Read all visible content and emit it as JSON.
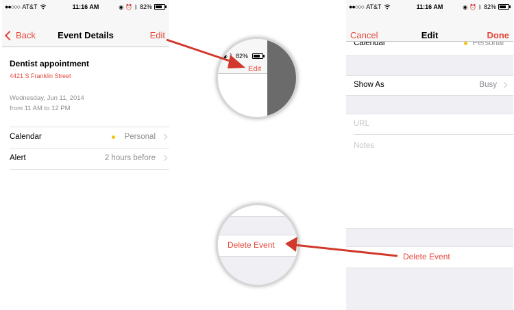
{
  "left_screen": {
    "status": {
      "signal": "●●○○○",
      "carrier": "AT&T",
      "time": "11:16 AM",
      "battery": "82%"
    },
    "nav": {
      "back_label": "Back",
      "title": "Event Details",
      "edit_label": "Edit"
    },
    "event": {
      "title": "Dentist appointment",
      "location": "4421 S Franklin Street",
      "date": "Wednesday, Jun 11, 2014",
      "time": "from 11 AM to 12 PM"
    },
    "rows": [
      {
        "label": "Calendar",
        "value": "Personal"
      },
      {
        "label": "Alert",
        "value": "2 hours before"
      }
    ]
  },
  "zoom_top": {
    "battery": "82%",
    "edit_label": "Edit"
  },
  "zoom_bottom": {
    "delete_label": "Delete Event"
  },
  "right_screen": {
    "status": {
      "signal": "●●○○○",
      "carrier": "AT&T",
      "time": "11:16 AM",
      "battery": "82%"
    },
    "nav": {
      "cancel_label": "Cancel",
      "title": "Edit",
      "done_label": "Done"
    },
    "calendar_row": {
      "label": "Calendar",
      "value": "Personal"
    },
    "show_as": {
      "label": "Show As",
      "value": "Busy"
    },
    "url_placeholder": "URL",
    "notes_placeholder": "Notes",
    "delete_label": "Delete Event"
  },
  "colors": {
    "accent": "#e4473a",
    "arrow": "#d0392b",
    "gray_bg": "#efeff4",
    "circle_dark": "#6b6b6b"
  },
  "icons": [
    "wifi-icon",
    "battery-icon",
    "bluetooth-icon",
    "alarm-icon",
    "lock-rotation-icon",
    "back-chevron-icon",
    "chevron-right-icon",
    "arrow-icon"
  ]
}
